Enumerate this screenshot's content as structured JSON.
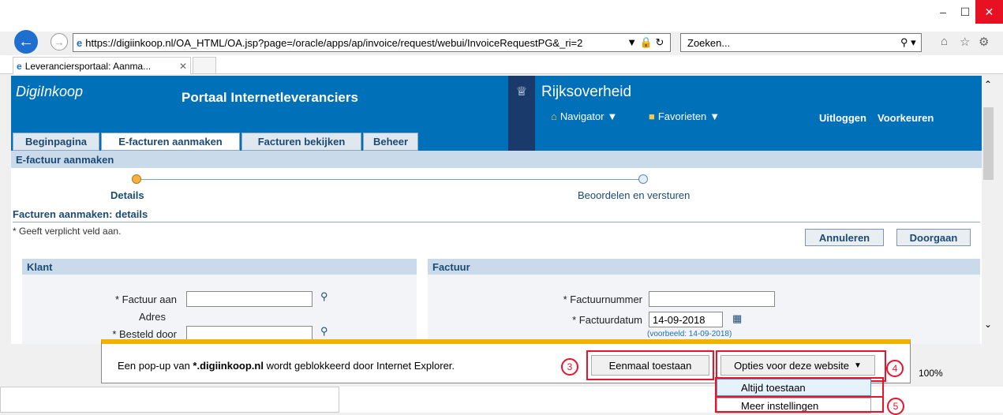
{
  "browser": {
    "url": "https://digiinkoop.nl/OA_HTML/OA.jsp?page=/oracle/apps/ap/invoice/request/webui/InvoiceRequestPG&_ri=2",
    "search_placeholder": "Zoeken...",
    "tab_title": "Leveranciersportaal: Aanma...",
    "zoom": "100%"
  },
  "header": {
    "brand": "DigiInkoop",
    "portal_title": "Portaal Internetleveranciers",
    "gov": "Rijksoverheid",
    "navigator": "Navigator",
    "favorites": "Favorieten",
    "logout": "Uitloggen",
    "prefs": "Voorkeuren"
  },
  "tabs": [
    "Beginpagina",
    "E-facturen aanmaken",
    "Facturen bekijken",
    "Beheer"
  ],
  "page": {
    "section_title": "E-factuur aanmaken",
    "step1": "Details",
    "step2": "Beoordelen en versturen",
    "subtitle": "Facturen aanmaken: details",
    "required_note": "* Geeft verplicht veld aan.",
    "cancel": "Annuleren",
    "continue": "Doorgaan"
  },
  "klant": {
    "title": "Klant",
    "factuur_aan": "* Factuur aan",
    "adres": "Adres",
    "besteld_door": "* Besteld door"
  },
  "factuur": {
    "title": "Factuur",
    "nummer_label": "* Factuurnummer",
    "datum_label": "* Factuurdatum",
    "datum_value": "14-09-2018",
    "example": "(voorbeeld: 14-09-2018)"
  },
  "popup": {
    "prefix": "Een pop-up van ",
    "domain": "*.digiinkoop.nl",
    "suffix": " wordt geblokkeerd door Internet Explorer.",
    "allow_once": "Eenmaal toestaan",
    "options": "Opties voor deze website",
    "always": "Altijd toestaan",
    "more": "Meer instellingen",
    "n3": "3",
    "n4": "4",
    "n5": "5"
  }
}
